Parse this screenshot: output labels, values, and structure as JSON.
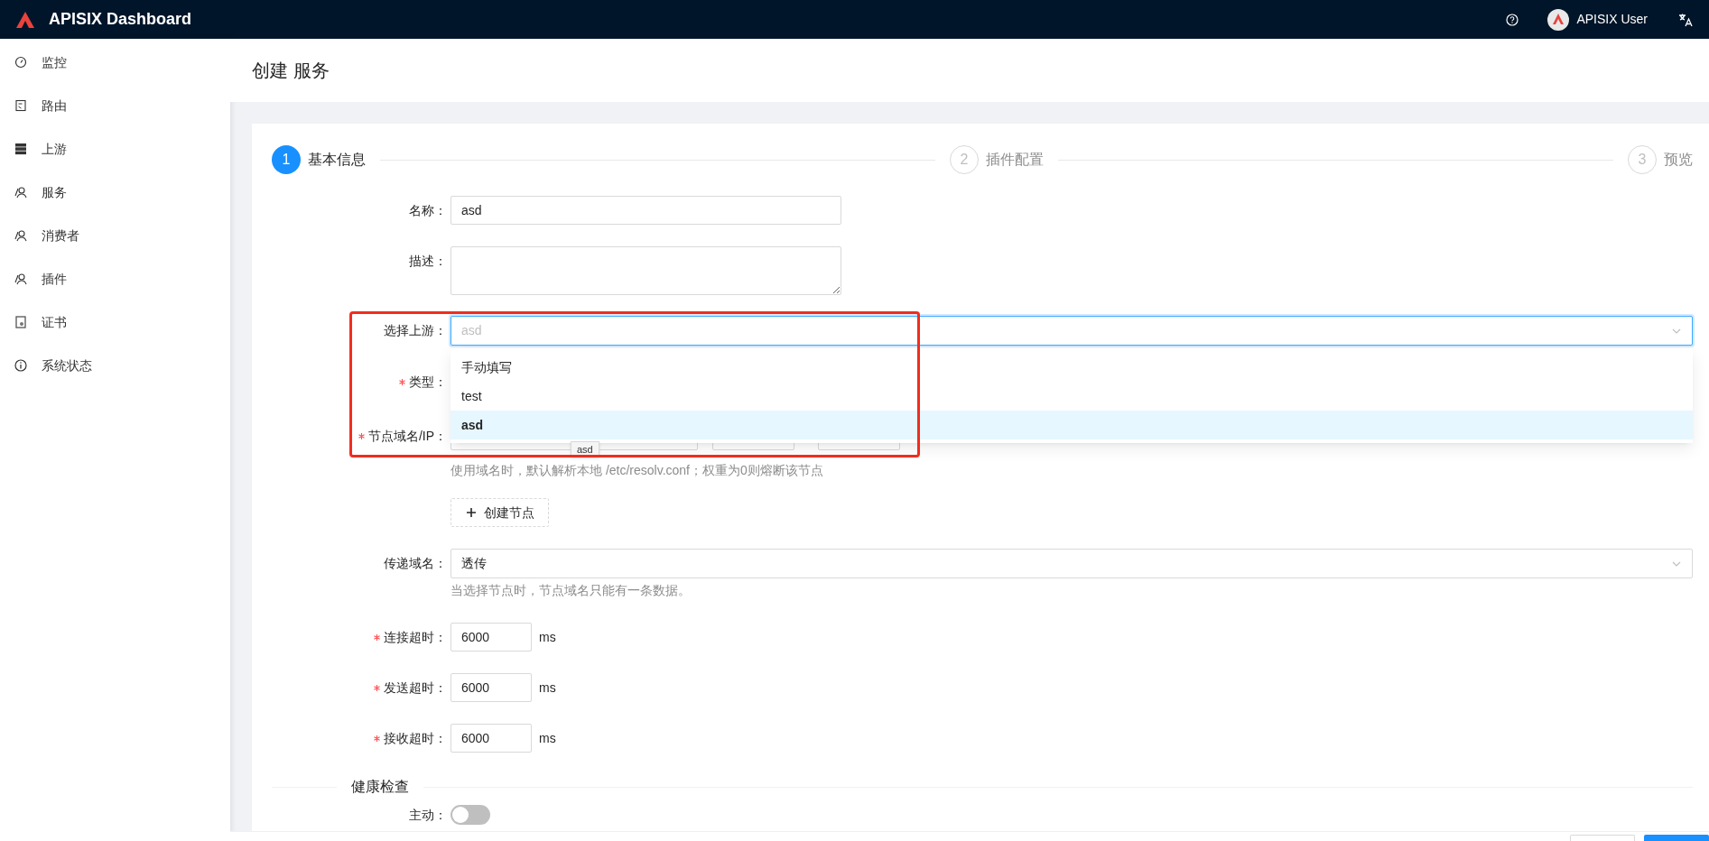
{
  "header": {
    "title": "APISIX Dashboard",
    "user": "APISIX User"
  },
  "sidebar": {
    "items": [
      {
        "label": "监控",
        "kind": "gauge"
      },
      {
        "label": "路由",
        "kind": "doc"
      },
      {
        "label": "上游",
        "kind": "server"
      },
      {
        "label": "服务",
        "kind": "people"
      },
      {
        "label": "消费者",
        "kind": "people"
      },
      {
        "label": "插件",
        "kind": "people"
      },
      {
        "label": "证书",
        "kind": "cert"
      },
      {
        "label": "系统状态",
        "kind": "info"
      }
    ]
  },
  "page_title": "创建 服务",
  "steps": [
    {
      "number": "1",
      "label": "基本信息",
      "selected": true
    },
    {
      "number": "2",
      "label": "插件配置",
      "selected": false
    },
    {
      "number": "3",
      "label": "预览",
      "selected": false
    }
  ],
  "form": [
    {
      "kind": "input",
      "label": "名称：",
      "required": false,
      "value": "asd"
    },
    {
      "kind": "textarea",
      "label": "描述：",
      "required": false
    },
    {
      "kind": "select",
      "label": "选择上游：",
      "required": false,
      "placeholder": "asd",
      "focused": true
    },
    {
      "kind": "covered",
      "label": "类型：",
      "required": true
    },
    {
      "kind": "nodes",
      "label": "节点域名/IP：",
      "required": true,
      "help": "使用域名时，默认解析本地 /etc/resolv.conf；权重为0则熔断该节点"
    },
    {
      "kind": "add",
      "label": "创建节点"
    },
    {
      "kind": "select",
      "label": "传递域名：",
      "required": false,
      "value": "透传",
      "focused": false,
      "help": "当选择节点时，节点域名只能有一条数据。"
    },
    {
      "kind": "number",
      "label": "连接超时：",
      "required": true,
      "value": "6000",
      "unit": "ms"
    },
    {
      "kind": "number",
      "label": "发送超时：",
      "required": true,
      "value": "6000",
      "unit": "ms"
    },
    {
      "kind": "number",
      "label": "接收超时：",
      "required": true,
      "value": "6000",
      "unit": "ms"
    }
  ],
  "upstream_dropdown": {
    "options": [
      {
        "label": "手动填写",
        "selected": false
      },
      {
        "label": "test",
        "selected": false
      },
      {
        "label": "asd",
        "selected": true
      }
    ]
  },
  "tooltip": "asd",
  "health_check": {
    "title": "健康检查",
    "active_label": "主动：",
    "active_on": false
  }
}
